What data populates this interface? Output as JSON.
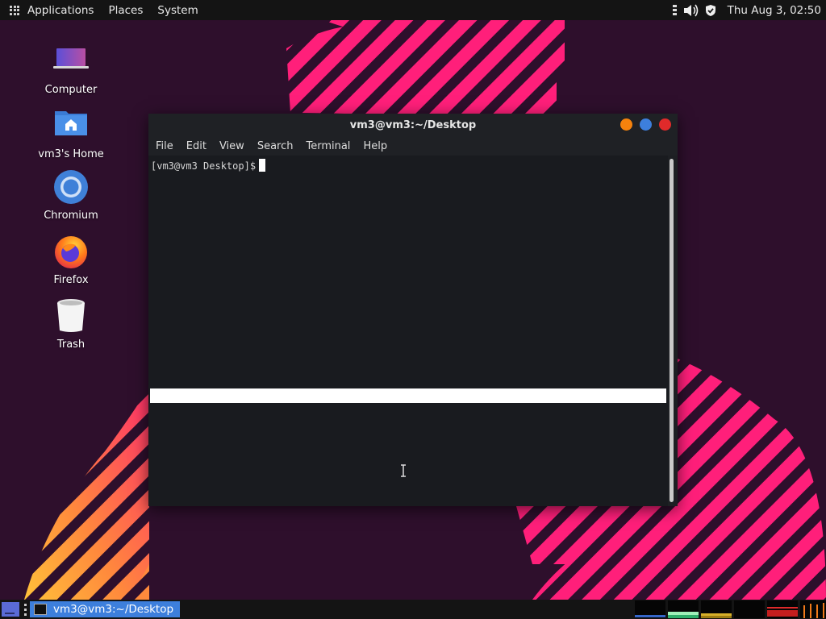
{
  "top_panel": {
    "menus": [
      "Applications",
      "Places",
      "System"
    ],
    "clock": "Thu Aug  3, 02:50",
    "tray_icons": [
      "grip-icon",
      "volume-icon",
      "shield-icon"
    ]
  },
  "desktop_icons": [
    {
      "label": "Computer",
      "icon": "computer-icon"
    },
    {
      "label": "vm3's Home",
      "icon": "home-folder-icon"
    },
    {
      "label": "Chromium",
      "icon": "chromium-icon"
    },
    {
      "label": "Firefox",
      "icon": "firefox-icon"
    },
    {
      "label": "Trash",
      "icon": "trash-icon"
    }
  ],
  "terminal": {
    "title": "vm3@vm3:~/Desktop",
    "menu": [
      "File",
      "Edit",
      "View",
      "Search",
      "Terminal",
      "Help"
    ],
    "prompt": "[vm3@vm3 Desktop]$",
    "window_button_colors": {
      "minimize": "#f5820d",
      "maximize": "#3d7fdc",
      "close": "#e02a2a"
    }
  },
  "taskbar": {
    "task_label": "vm3@vm3:~/Desktop"
  },
  "colors": {
    "accent": "#3d7fdc",
    "wallpaper": "#2e0f2c",
    "stripe_pink": "#ff1f7a",
    "stripe_orange": "#ff8a3c",
    "stripe_yellow": "#ffc23a"
  }
}
